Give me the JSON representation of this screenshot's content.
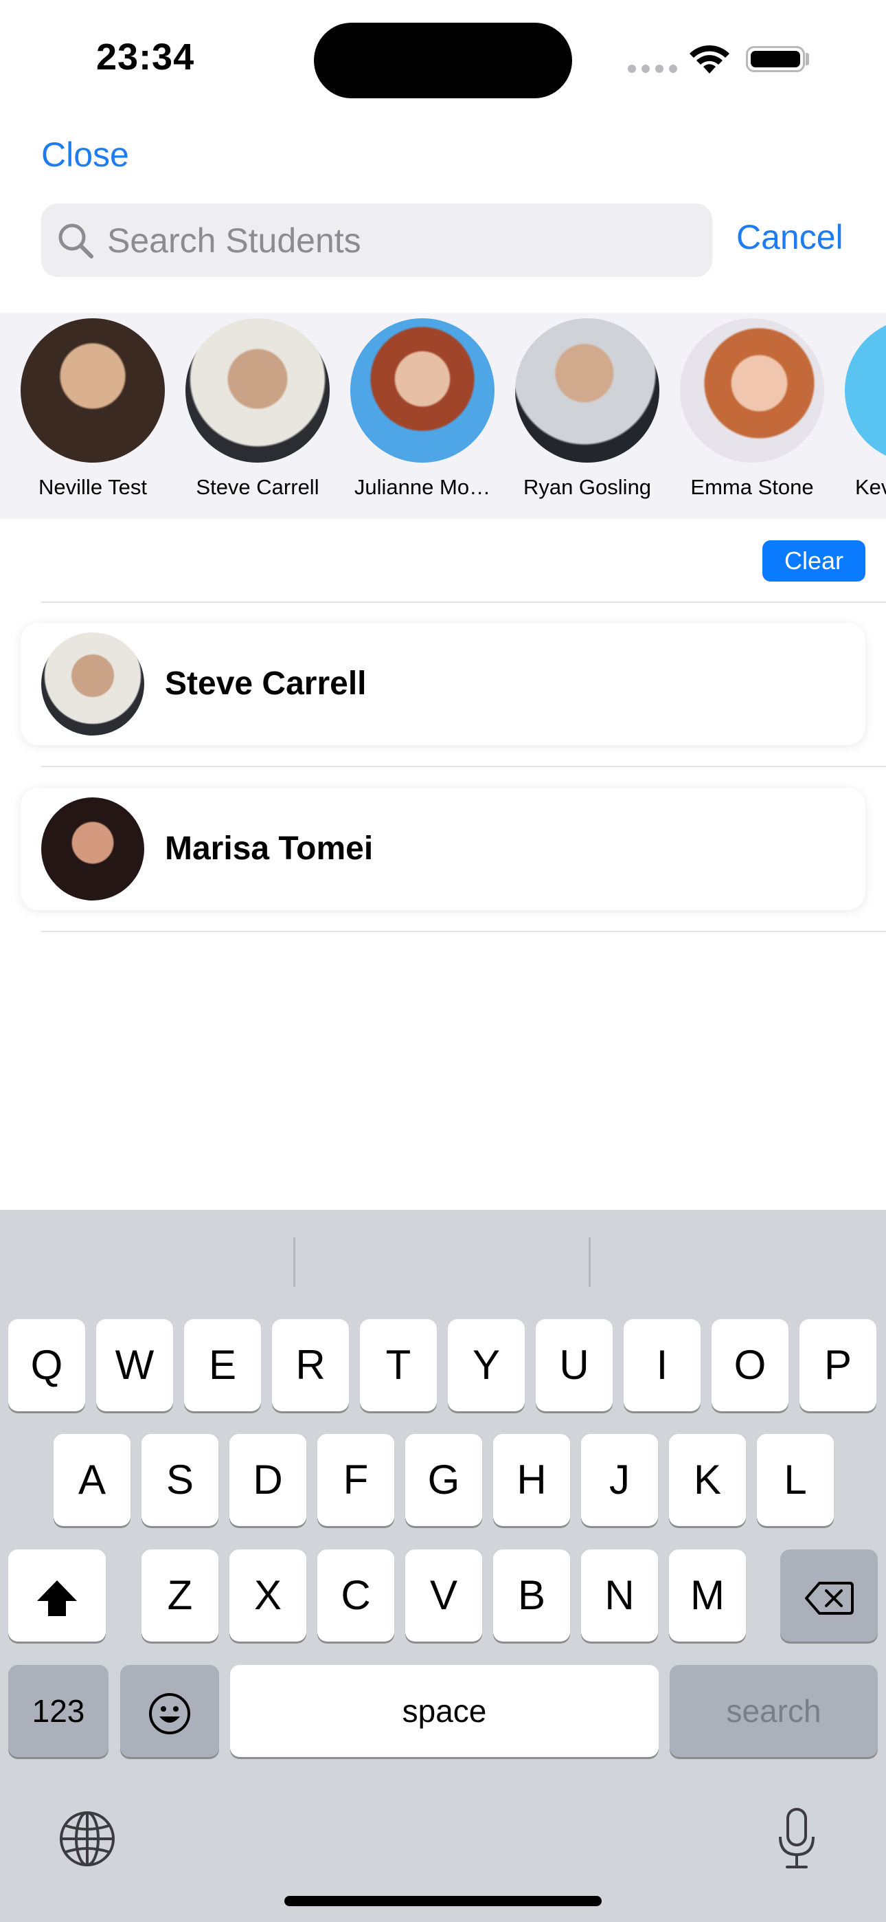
{
  "status_bar": {
    "time": "23:34"
  },
  "nav": {
    "close_label": "Close",
    "cancel_label": "Cancel"
  },
  "search": {
    "placeholder": "Search Students",
    "value": ""
  },
  "recent_strip": [
    {
      "name": "Neville Test",
      "bg": "#3b2a22"
    },
    {
      "name": "Steve Carrell",
      "bg": "#e8e6df"
    },
    {
      "name": "Julianne Mo…",
      "bg": "#4fa6e6"
    },
    {
      "name": "Ryan Gosling",
      "bg": "#cfd3d8"
    },
    {
      "name": "Emma Stone",
      "bg": "#e6e4ea"
    },
    {
      "name": "Kev",
      "bg": "#59c4f2"
    }
  ],
  "clear_label": "Clear",
  "results": [
    {
      "name": "Steve Carrell"
    },
    {
      "name": "Marisa Tomei"
    }
  ],
  "keyboard": {
    "row1": [
      "Q",
      "W",
      "E",
      "R",
      "T",
      "Y",
      "U",
      "I",
      "O",
      "P"
    ],
    "row2": [
      "A",
      "S",
      "D",
      "F",
      "G",
      "H",
      "J",
      "K",
      "L"
    ],
    "row3": [
      "Z",
      "X",
      "C",
      "V",
      "B",
      "N",
      "M"
    ],
    "numbers_label": "123",
    "space_label": "space",
    "search_label": "search"
  },
  "colors": {
    "accent": "#1f7cf0",
    "clear_button": "#0a7aff"
  },
  "icons": [
    "search-icon",
    "wifi-icon",
    "battery-icon",
    "shift-icon",
    "backspace-icon",
    "emoji-icon",
    "globe-icon",
    "microphone-icon"
  ]
}
